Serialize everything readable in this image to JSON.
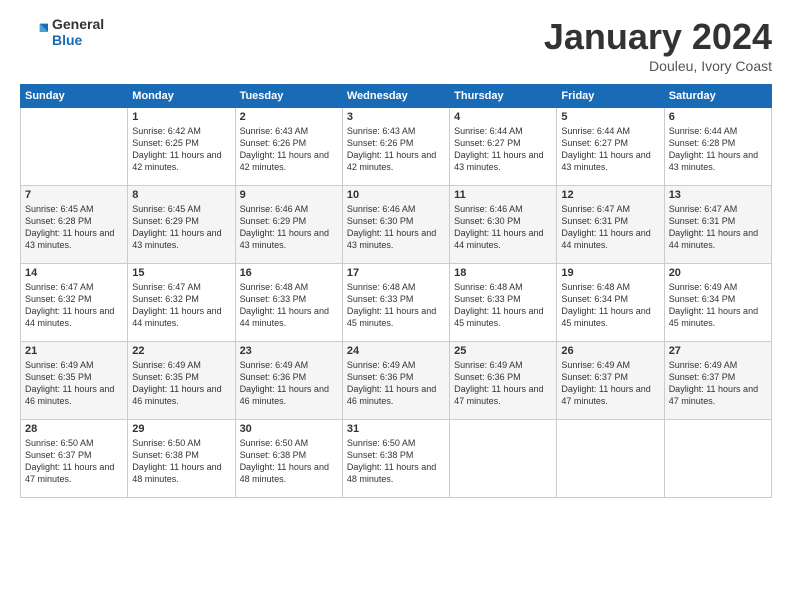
{
  "header": {
    "logo_general": "General",
    "logo_blue": "Blue",
    "month_title": "January 2024",
    "subtitle": "Douleu, Ivory Coast"
  },
  "days_of_week": [
    "Sunday",
    "Monday",
    "Tuesday",
    "Wednesday",
    "Thursday",
    "Friday",
    "Saturday"
  ],
  "weeks": [
    [
      {
        "day": "",
        "sunrise": "",
        "sunset": "",
        "daylight": ""
      },
      {
        "day": "1",
        "sunrise": "Sunrise: 6:42 AM",
        "sunset": "Sunset: 6:25 PM",
        "daylight": "Daylight: 11 hours and 42 minutes."
      },
      {
        "day": "2",
        "sunrise": "Sunrise: 6:43 AM",
        "sunset": "Sunset: 6:26 PM",
        "daylight": "Daylight: 11 hours and 42 minutes."
      },
      {
        "day": "3",
        "sunrise": "Sunrise: 6:43 AM",
        "sunset": "Sunset: 6:26 PM",
        "daylight": "Daylight: 11 hours and 42 minutes."
      },
      {
        "day": "4",
        "sunrise": "Sunrise: 6:44 AM",
        "sunset": "Sunset: 6:27 PM",
        "daylight": "Daylight: 11 hours and 43 minutes."
      },
      {
        "day": "5",
        "sunrise": "Sunrise: 6:44 AM",
        "sunset": "Sunset: 6:27 PM",
        "daylight": "Daylight: 11 hours and 43 minutes."
      },
      {
        "day": "6",
        "sunrise": "Sunrise: 6:44 AM",
        "sunset": "Sunset: 6:28 PM",
        "daylight": "Daylight: 11 hours and 43 minutes."
      }
    ],
    [
      {
        "day": "7",
        "sunrise": "Sunrise: 6:45 AM",
        "sunset": "Sunset: 6:28 PM",
        "daylight": "Daylight: 11 hours and 43 minutes."
      },
      {
        "day": "8",
        "sunrise": "Sunrise: 6:45 AM",
        "sunset": "Sunset: 6:29 PM",
        "daylight": "Daylight: 11 hours and 43 minutes."
      },
      {
        "day": "9",
        "sunrise": "Sunrise: 6:46 AM",
        "sunset": "Sunset: 6:29 PM",
        "daylight": "Daylight: 11 hours and 43 minutes."
      },
      {
        "day": "10",
        "sunrise": "Sunrise: 6:46 AM",
        "sunset": "Sunset: 6:30 PM",
        "daylight": "Daylight: 11 hours and 43 minutes."
      },
      {
        "day": "11",
        "sunrise": "Sunrise: 6:46 AM",
        "sunset": "Sunset: 6:30 PM",
        "daylight": "Daylight: 11 hours and 44 minutes."
      },
      {
        "day": "12",
        "sunrise": "Sunrise: 6:47 AM",
        "sunset": "Sunset: 6:31 PM",
        "daylight": "Daylight: 11 hours and 44 minutes."
      },
      {
        "day": "13",
        "sunrise": "Sunrise: 6:47 AM",
        "sunset": "Sunset: 6:31 PM",
        "daylight": "Daylight: 11 hours and 44 minutes."
      }
    ],
    [
      {
        "day": "14",
        "sunrise": "Sunrise: 6:47 AM",
        "sunset": "Sunset: 6:32 PM",
        "daylight": "Daylight: 11 hours and 44 minutes."
      },
      {
        "day": "15",
        "sunrise": "Sunrise: 6:47 AM",
        "sunset": "Sunset: 6:32 PM",
        "daylight": "Daylight: 11 hours and 44 minutes."
      },
      {
        "day": "16",
        "sunrise": "Sunrise: 6:48 AM",
        "sunset": "Sunset: 6:33 PM",
        "daylight": "Daylight: 11 hours and 44 minutes."
      },
      {
        "day": "17",
        "sunrise": "Sunrise: 6:48 AM",
        "sunset": "Sunset: 6:33 PM",
        "daylight": "Daylight: 11 hours and 45 minutes."
      },
      {
        "day": "18",
        "sunrise": "Sunrise: 6:48 AM",
        "sunset": "Sunset: 6:33 PM",
        "daylight": "Daylight: 11 hours and 45 minutes."
      },
      {
        "day": "19",
        "sunrise": "Sunrise: 6:48 AM",
        "sunset": "Sunset: 6:34 PM",
        "daylight": "Daylight: 11 hours and 45 minutes."
      },
      {
        "day": "20",
        "sunrise": "Sunrise: 6:49 AM",
        "sunset": "Sunset: 6:34 PM",
        "daylight": "Daylight: 11 hours and 45 minutes."
      }
    ],
    [
      {
        "day": "21",
        "sunrise": "Sunrise: 6:49 AM",
        "sunset": "Sunset: 6:35 PM",
        "daylight": "Daylight: 11 hours and 46 minutes."
      },
      {
        "day": "22",
        "sunrise": "Sunrise: 6:49 AM",
        "sunset": "Sunset: 6:35 PM",
        "daylight": "Daylight: 11 hours and 46 minutes."
      },
      {
        "day": "23",
        "sunrise": "Sunrise: 6:49 AM",
        "sunset": "Sunset: 6:36 PM",
        "daylight": "Daylight: 11 hours and 46 minutes."
      },
      {
        "day": "24",
        "sunrise": "Sunrise: 6:49 AM",
        "sunset": "Sunset: 6:36 PM",
        "daylight": "Daylight: 11 hours and 46 minutes."
      },
      {
        "day": "25",
        "sunrise": "Sunrise: 6:49 AM",
        "sunset": "Sunset: 6:36 PM",
        "daylight": "Daylight: 11 hours and 47 minutes."
      },
      {
        "day": "26",
        "sunrise": "Sunrise: 6:49 AM",
        "sunset": "Sunset: 6:37 PM",
        "daylight": "Daylight: 11 hours and 47 minutes."
      },
      {
        "day": "27",
        "sunrise": "Sunrise: 6:49 AM",
        "sunset": "Sunset: 6:37 PM",
        "daylight": "Daylight: 11 hours and 47 minutes."
      }
    ],
    [
      {
        "day": "28",
        "sunrise": "Sunrise: 6:50 AM",
        "sunset": "Sunset: 6:37 PM",
        "daylight": "Daylight: 11 hours and 47 minutes."
      },
      {
        "day": "29",
        "sunrise": "Sunrise: 6:50 AM",
        "sunset": "Sunset: 6:38 PM",
        "daylight": "Daylight: 11 hours and 48 minutes."
      },
      {
        "day": "30",
        "sunrise": "Sunrise: 6:50 AM",
        "sunset": "Sunset: 6:38 PM",
        "daylight": "Daylight: 11 hours and 48 minutes."
      },
      {
        "day": "31",
        "sunrise": "Sunrise: 6:50 AM",
        "sunset": "Sunset: 6:38 PM",
        "daylight": "Daylight: 11 hours and 48 minutes."
      },
      {
        "day": "",
        "sunrise": "",
        "sunset": "",
        "daylight": ""
      },
      {
        "day": "",
        "sunrise": "",
        "sunset": "",
        "daylight": ""
      },
      {
        "day": "",
        "sunrise": "",
        "sunset": "",
        "daylight": ""
      }
    ]
  ]
}
